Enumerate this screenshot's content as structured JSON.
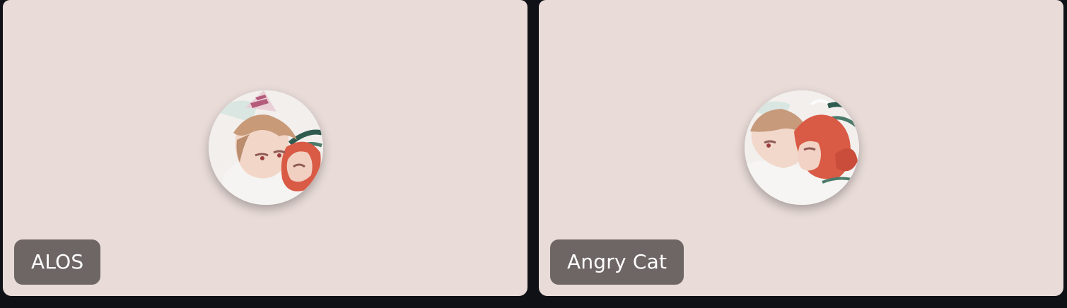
{
  "participants": [
    {
      "name": "ALOS",
      "avatar_icon": "avatar-icon",
      "colors": {
        "tile_bg": "#e8dbd8",
        "badge_bg": "#635c5a",
        "badge_text": "#ffffff"
      }
    },
    {
      "name": "Angry Cat",
      "avatar_icon": "avatar-icon",
      "colors": {
        "tile_bg": "#e8dbd8",
        "badge_bg": "#635c5a",
        "badge_text": "#ffffff"
      }
    }
  ],
  "background": "#0f1116"
}
